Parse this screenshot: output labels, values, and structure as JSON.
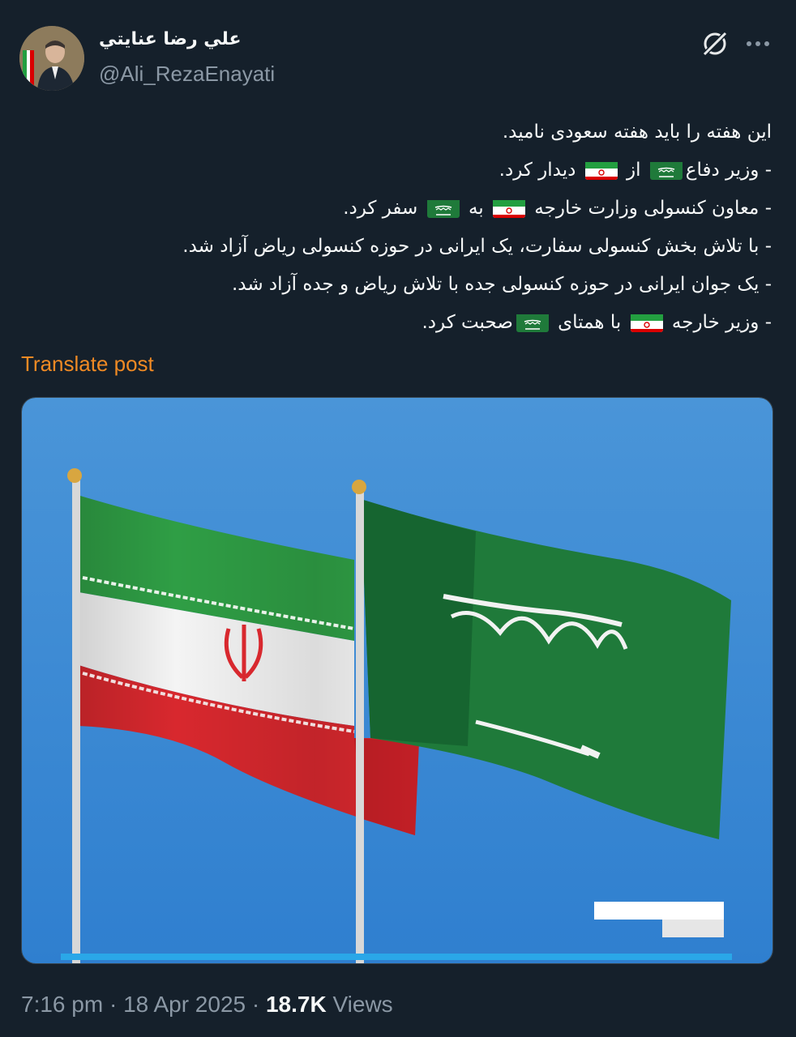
{
  "author": {
    "display_name": "علي رضا عنايتي",
    "handle": "@Ali_RezaEnayati",
    "avatar_icon": "profile-photo"
  },
  "header_icons": {
    "grok": "grok-icon",
    "more": "more-icon"
  },
  "post": {
    "lines": [
      {
        "parts": [
          {
            "t": "این هفته را باید هفته سعودی نامید."
          }
        ]
      },
      {
        "parts": [
          {
            "t": "- وزیر دفاع"
          },
          {
            "flag": "saudi"
          },
          {
            "t": " از "
          },
          {
            "flag": "iran"
          },
          {
            "t": " دیدار کرد."
          }
        ]
      },
      {
        "parts": [
          {
            "t": "- معاون کنسولی وزارت خارجه "
          },
          {
            "flag": "iran"
          },
          {
            "t": " به "
          },
          {
            "flag": "saudi"
          },
          {
            "t": " سفر کرد."
          }
        ]
      },
      {
        "parts": [
          {
            "t": "- با تلاش بخش کنسولی سفارت، یک ایرانی در حوزه کنسولی ریاض آزاد شد."
          }
        ]
      },
      {
        "parts": [
          {
            "t": "- یک جوان ایرانی در حوزه کنسولی جده با تلاش ریاض و جده آزاد شد."
          }
        ]
      },
      {
        "parts": [
          {
            "t": "- وزیر خارجه "
          },
          {
            "flag": "iran"
          },
          {
            "t": " با همتای "
          },
          {
            "flag": "saudi"
          },
          {
            "t": "صحبت کرد."
          }
        ]
      }
    ]
  },
  "translate_label": "Translate post",
  "media": {
    "description_icon": "iran-saudi-flags-photo",
    "colors": {
      "sky": "#3f8fd6",
      "iran_green": "#239f40",
      "iran_red": "#da0000",
      "saudi_green": "#1f7a3a"
    }
  },
  "meta": {
    "time": "7:16 pm",
    "sep1": " · ",
    "date": "18 Apr 2025",
    "sep2": " · ",
    "views_count": "18.7K",
    "views_label": " Views"
  }
}
